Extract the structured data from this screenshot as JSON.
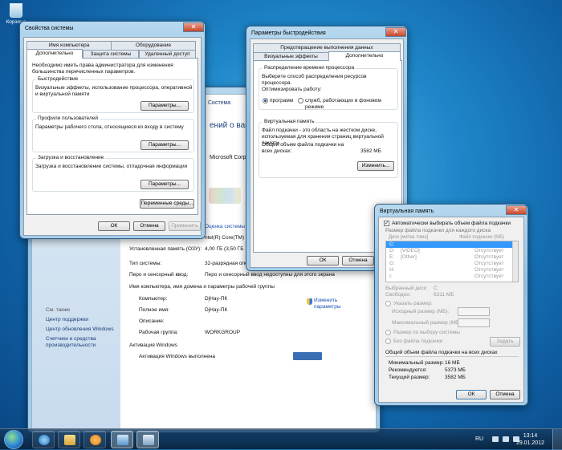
{
  "desktop": {
    "recycle_bin_label": "Корзина"
  },
  "bg_window": {
    "breadcrumb_fragment": "Система",
    "heading_fragment": "ений о ваш",
    "corp_fragment": "Microsoft Corp",
    "rows": [
      {
        "label": "",
        "value": "Оценка системы"
      },
      {
        "label": "",
        "value": "ntel(R) Core(TM)"
      },
      {
        "label": "Установленная память (ОЗУ):",
        "value": "4,00 ГБ (3,50 ГБ"
      },
      {
        "label": "Тип системы:",
        "value": "32-разрядная опе"
      },
      {
        "label": "Перо и сенсорный ввод:",
        "value": "Перо и сенсорный ввод недоступны для этого экрана"
      }
    ],
    "section_computer": "Имя компьютера, имя домена и параметры рабочей группы",
    "rows2": [
      {
        "label": "Компьютер:",
        "value": "DjHay-ПК"
      },
      {
        "label": "Полное имя:",
        "value": "DjHay-ПК"
      },
      {
        "label": "Описание:",
        "value": ""
      },
      {
        "label": "Рабочая группа:",
        "value": "WORKGROUP"
      }
    ],
    "change_link": "Изменить параметры",
    "section_activation": "Активация Windows",
    "activation_text": "Активация Windows выполнена",
    "see_also": "См. также",
    "links": [
      "Центр поддержки",
      "Центр обновления Windows",
      "Счетчики и средства производительности"
    ]
  },
  "sysprops": {
    "title": "Свойства системы",
    "tabs_back": [
      "Имя компьютера",
      "Оборудование"
    ],
    "tabs_front": [
      "Дополнительно",
      "Защита системы",
      "Удаленный доступ"
    ],
    "admin_note": "Необходимо иметь права администратора для изменения большинства перечисленных параметров.",
    "perf": {
      "title": "Быстродействие",
      "text": "Визуальные эффекты, использование процессора, оперативной и виртуальной памяти",
      "button": "Параметры..."
    },
    "profiles": {
      "title": "Профили пользователей",
      "text": "Параметры рабочего стола, относящиеся ко входу в систему",
      "button": "Параметры..."
    },
    "startup": {
      "title": "Загрузка и восстановление",
      "text": "Загрузка и восстановление системы, отладочная информация",
      "button": "Параметры..."
    },
    "env_button": "Переменные среды...",
    "ok": "ОК",
    "cancel": "Отмена",
    "apply": "Применить"
  },
  "perfopts": {
    "title": "Параметры быстродействия",
    "tab_back": "Предотвращение выполнения данных",
    "tabs_front": [
      "Визуальные эффекты",
      "Дополнительно"
    ],
    "cpu_group": "Распределение времени процессора",
    "cpu_desc": "Выберите способ распределения ресурсов процессора.",
    "optimize_label": "Оптимизировать работу:",
    "radio_programs": "программ",
    "radio_services": "служб, работающих в фоновом режиме",
    "vm_group": "Виртуальная память",
    "vm_desc": "Файл подкачки - это область на жестком диске, используемая для хранения страниц виртуальной памяти.",
    "vm_total_label": "Общий объем файла подкачки на всех дисках:",
    "vm_total_value": "3582 МБ",
    "change_button": "Изменить...",
    "ok": "ОК",
    "cancel": "Отмена"
  },
  "vmem": {
    "title": "Виртуальная память",
    "auto_label": "Автоматически выбирать объем файла подкачки",
    "per_drive_label": "Размер файла подкачки для каждого диска",
    "col_drive": "Диск [метка тома]",
    "col_size": "Файл подкачки (МБ)",
    "drives": [
      {
        "drive": "C:",
        "label": "",
        "status": ""
      },
      {
        "drive": "D:",
        "label": "[VIDEO]",
        "status": "Отсутствует"
      },
      {
        "drive": "E:",
        "label": "[Other]",
        "status": "Отсутствует"
      },
      {
        "drive": "G:",
        "label": "",
        "status": "Отсутствует"
      },
      {
        "drive": "H:",
        "label": "",
        "status": "Отсутствует"
      },
      {
        "drive": "I:",
        "label": "",
        "status": "Отсутствует"
      }
    ],
    "selected_drive_label": "Выбранный диск:",
    "selected_drive_value": "C:",
    "free_label": "Свободно:",
    "free_value": "6311 МБ",
    "radio_custom": "Указать размер:",
    "initial_label": "Исходный размер (МБ):",
    "max_label": "Максимальный размер (МБ):",
    "radio_system": "Размер по выбору системы",
    "radio_none": "Без файла подкачки",
    "set_button": "Задать",
    "total_group": "Общий объем файла подкачки на всех дисках",
    "min_label": "Минимальный размер:",
    "min_value": "16 МБ",
    "rec_label": "Рекомендуется:",
    "rec_value": "5373 МБ",
    "cur_label": "Текущий размер:",
    "cur_value": "3582 МБ",
    "ok": "ОК",
    "cancel": "Отмена"
  },
  "taskbar": {
    "lang": "RU",
    "time": "13:14",
    "date": "29.01.2012"
  }
}
